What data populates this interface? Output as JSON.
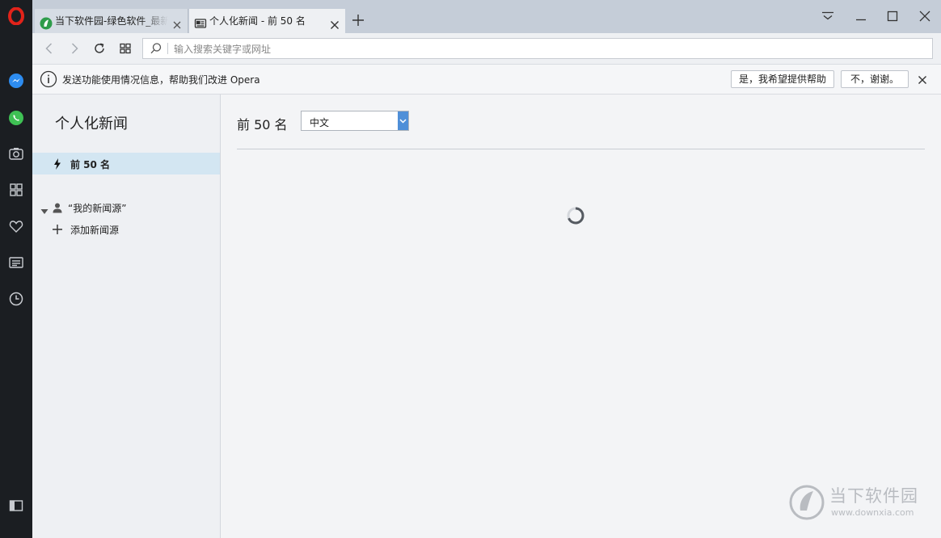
{
  "tabs": [
    {
      "title": "当下软件园-绿色软件_最新",
      "icon": "site-favicon-icon",
      "active": false
    },
    {
      "title": "个人化新闻 - 前 50 名",
      "icon": "news-icon",
      "active": true
    }
  ],
  "toolbar": {
    "address_placeholder": "输入搜索关键字或网址"
  },
  "infobar": {
    "message": "发送功能使用情况信息，帮助我们改进 Opera",
    "yes_label": "是，我希望提供帮助",
    "no_label": "不，谢谢。"
  },
  "sidebar": {
    "icons": [
      "opera-logo-icon",
      "messenger-icon",
      "whatsapp-icon",
      "camera-icon",
      "speed-dial-icon",
      "heart-icon",
      "news-icon",
      "history-icon",
      "sidebar-toggle-icon"
    ]
  },
  "news": {
    "panel_title": "个人化新闻",
    "top_item_label": "前 50 名",
    "group_label": "“我的新闻源”",
    "add_source_label": "添加新闻源",
    "main_title": "前 50 名",
    "language_selected": "中文",
    "loading": true
  },
  "watermark": {
    "brand": "当下软件园",
    "url": "www.downxia.com"
  },
  "colors": {
    "sidebar_bg": "#1b1e22",
    "opera_red": "#e2231a",
    "selected_item": "#d3e6f2",
    "dropdown_accent": "#4f8fd8"
  }
}
